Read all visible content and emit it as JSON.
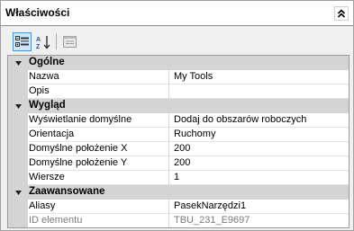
{
  "panel": {
    "title": "Właściwości"
  },
  "toolbar": {
    "categorized_icon": "categorized-icon",
    "alphabetical_icon": "alphabetical-sort-icon",
    "property_pages_icon": "property-pages-icon"
  },
  "categories": [
    {
      "label": "Ogólne",
      "properties": [
        {
          "name": "Nazwa",
          "value": "My Tools",
          "readonly": false
        },
        {
          "name": "Opis",
          "value": "",
          "readonly": false
        }
      ]
    },
    {
      "label": "Wygląd",
      "properties": [
        {
          "name": "Wyświetlanie domyślne",
          "value": "Dodaj do obszarów roboczych",
          "readonly": false
        },
        {
          "name": "Orientacja",
          "value": "Ruchomy",
          "readonly": false
        },
        {
          "name": "Domyślne położenie X",
          "value": "200",
          "readonly": false
        },
        {
          "name": "Domyślne położenie Y",
          "value": "200",
          "readonly": false
        },
        {
          "name": "Wiersze",
          "value": "1",
          "readonly": false
        }
      ]
    },
    {
      "label": "Zaawansowane",
      "properties": [
        {
          "name": "Aliasy",
          "value": "PasekNarzędzi1",
          "readonly": false
        },
        {
          "name": "ID elementu",
          "value": "TBU_231_E9697",
          "readonly": true
        }
      ]
    }
  ]
}
